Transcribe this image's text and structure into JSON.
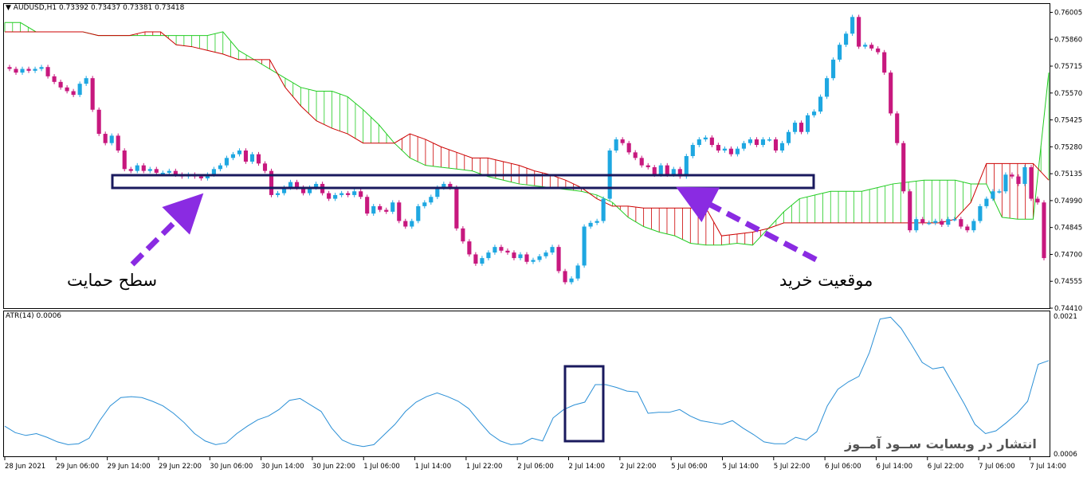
{
  "header": {
    "symbol_text": "AUDUSD,H1",
    "ohlc": "0.73392 0.73437 0.73381 0.73418",
    "menu_icon": "triangle-down-icon"
  },
  "atr_panel": {
    "label": "ATR(14) 0.0006",
    "y_ticks": [
      "0.0021",
      "0.0006"
    ]
  },
  "annotations": {
    "support": "سطح حمایت",
    "buy": "موقعیت خرید",
    "watermark": "انتشار در وبسایت ســود آمــوز"
  },
  "colors": {
    "bull": "#1ea7e1",
    "bear": "#c7187e",
    "cloud_bear": "#cc0000",
    "cloud_bull": "#22cc22",
    "atr": "#2a8fd6",
    "box": "#1a1a5e",
    "arrow": "#8a2be2"
  },
  "chart_data": [
    {
      "type": "candlestick",
      "title": "AUDUSD,H1",
      "ylim": [
        0.7441,
        0.7605
      ],
      "y_ticks": [
        "0.76005",
        "0.75860",
        "0.75715",
        "0.75570",
        "0.75425",
        "0.75280",
        "0.75135",
        "0.74990",
        "0.74845",
        "0.74700",
        "0.74555",
        "0.74410"
      ],
      "x_ticks": [
        "28 Jun 2021",
        "29 Jun 06:00",
        "29 Jun 14:00",
        "29 Jun 22:00",
        "30 Jun 06:00",
        "30 Jun 14:00",
        "30 Jun 22:00",
        "1 Jul 06:00",
        "1 Jul 14:00",
        "1 Jul 22:00",
        "2 Jul 06:00",
        "2 Jul 14:00",
        "2 Jul 22:00",
        "5 Jul 06:00",
        "5 Jul 14:00",
        "5 Jul 22:00",
        "6 Jul 06:00",
        "6 Jul 14:00",
        "6 Jul 22:00",
        "7 Jul 06:00",
        "7 Jul 14:00"
      ],
      "close": [
        0.757,
        0.7568,
        0.757,
        0.7569,
        0.757,
        0.7571,
        0.7566,
        0.7563,
        0.756,
        0.7558,
        0.7556,
        0.7562,
        0.7565,
        0.7548,
        0.7535,
        0.753,
        0.7534,
        0.7526,
        0.7516,
        0.7515,
        0.7518,
        0.7515,
        0.7516,
        0.7514,
        0.7514,
        0.7515,
        0.7513,
        0.7512,
        0.7513,
        0.7512,
        0.7511,
        0.7513,
        0.7516,
        0.7518,
        0.7522,
        0.7524,
        0.7526,
        0.752,
        0.7524,
        0.7519,
        0.7515,
        0.7502,
        0.7503,
        0.7506,
        0.7509,
        0.7506,
        0.7503,
        0.7506,
        0.7508,
        0.7503,
        0.75,
        0.7502,
        0.7503,
        0.7502,
        0.7504,
        0.7501,
        0.7492,
        0.7496,
        0.7494,
        0.7493,
        0.7498,
        0.7488,
        0.7485,
        0.7488,
        0.7496,
        0.7498,
        0.7501,
        0.7506,
        0.7508,
        0.7506,
        0.7484,
        0.7477,
        0.747,
        0.7465,
        0.7468,
        0.7471,
        0.7474,
        0.7472,
        0.7471,
        0.7468,
        0.747,
        0.7466,
        0.7467,
        0.7469,
        0.7471,
        0.7474,
        0.7461,
        0.7455,
        0.7457,
        0.7464,
        0.7485,
        0.7487,
        0.7488,
        0.75,
        0.7526,
        0.7532,
        0.753,
        0.7525,
        0.7522,
        0.7518,
        0.7517,
        0.7513,
        0.7518,
        0.7513,
        0.7516,
        0.7512,
        0.7523,
        0.7529,
        0.7532,
        0.7533,
        0.7529,
        0.7526,
        0.7527,
        0.7524,
        0.7527,
        0.753,
        0.7532,
        0.7529,
        0.7532,
        0.7532,
        0.7526,
        0.753,
        0.7536,
        0.7541,
        0.7536,
        0.7545,
        0.7547,
        0.7555,
        0.7565,
        0.7575,
        0.7583,
        0.7589,
        0.7598,
        0.7582,
        0.7583,
        0.7581,
        0.7579,
        0.7568,
        0.7546,
        0.753,
        0.7504,
        0.7483,
        0.7489,
        0.7487,
        0.7487,
        0.7488,
        0.7486,
        0.7489,
        0.7489,
        0.7485,
        0.7483,
        0.7488,
        0.7496,
        0.75,
        0.7504,
        0.7504,
        0.7513,
        0.7512,
        0.7508,
        0.7517,
        0.75,
        0.7498,
        0.7468
      ],
      "series": [
        {
          "name": "Ichimoku Senkou Span A",
          "values": [
            0.7595,
            0.7595,
            0.759,
            0.759,
            0.759,
            0.759,
            0.7588,
            0.7588,
            0.7588,
            0.7588,
            0.7588,
            0.7588,
            0.7588,
            0.7588,
            0.759,
            0.758,
            0.7575,
            0.757,
            0.7565,
            0.756,
            0.7558,
            0.7558,
            0.7555,
            0.7548,
            0.754,
            0.753,
            0.7522,
            0.7518,
            0.7517,
            0.7516,
            0.7515,
            0.7512,
            0.751,
            0.7508,
            0.7507,
            0.7506,
            0.7505,
            0.7504,
            0.7502,
            0.7498,
            0.749,
            0.7485,
            0.7482,
            0.748,
            0.7476,
            0.7475,
            0.7475,
            0.7476,
            0.7475,
            0.7484,
            0.7493,
            0.75,
            0.7502,
            0.7504,
            0.7504,
            0.7504,
            0.7506,
            0.7508,
            0.7509,
            0.751,
            0.751,
            0.751,
            0.7508,
            0.7508,
            0.749,
            0.7489,
            0.7489,
            0.7568
          ]
        },
        {
          "name": "Ichimoku Senkou Span B",
          "values": [
            0.759,
            0.759,
            0.759,
            0.759,
            0.759,
            0.759,
            0.7588,
            0.7588,
            0.7588,
            0.759,
            0.759,
            0.7583,
            0.7582,
            0.758,
            0.7578,
            0.7575,
            0.7575,
            0.7575,
            0.756,
            0.755,
            0.7542,
            0.7538,
            0.7535,
            0.753,
            0.753,
            0.753,
            0.7535,
            0.7532,
            0.7528,
            0.7525,
            0.7522,
            0.7522,
            0.752,
            0.7518,
            0.7515,
            0.7513,
            0.751,
            0.7506,
            0.75,
            0.7496,
            0.7496,
            0.7495,
            0.7495,
            0.7495,
            0.7495,
            0.7495,
            0.748,
            0.7481,
            0.7482,
            0.7484,
            0.7487,
            0.7487,
            0.7487,
            0.7487,
            0.7487,
            0.7487,
            0.7487,
            0.7487,
            0.7487,
            0.7487,
            0.7487,
            0.7489,
            0.7498,
            0.7519,
            0.7519,
            0.7519,
            0.7519,
            0.751
          ]
        }
      ]
    },
    {
      "type": "line",
      "title": "ATR(14) 0.0006",
      "ylim": [
        0.0006,
        0.0021
      ],
      "series": [
        {
          "name": "ATR(14)",
          "values": [
            0.0009,
            0.00083,
            0.0008,
            0.00082,
            0.00078,
            0.00073,
            0.0007,
            0.00071,
            0.00077,
            0.00096,
            0.00112,
            0.00121,
            0.00122,
            0.00121,
            0.00117,
            0.00112,
            0.00104,
            0.00094,
            0.00082,
            0.00074,
            0.0007,
            0.00072,
            0.00082,
            0.0009,
            0.00097,
            0.00101,
            0.00108,
            0.00118,
            0.0012,
            0.00113,
            0.00106,
            0.00088,
            0.00075,
            0.0007,
            0.00068,
            0.0007,
            0.00081,
            0.00092,
            0.00106,
            0.00116,
            0.00122,
            0.00126,
            0.00122,
            0.00117,
            0.00109,
            0.00095,
            0.00082,
            0.00074,
            0.0007,
            0.00071,
            0.00077,
            0.00074,
            0.00099,
            0.00108,
            0.00113,
            0.00116,
            0.00135,
            0.00135,
            0.00132,
            0.00128,
            0.00127,
            0.00104,
            0.00105,
            0.00105,
            0.00108,
            0.00101,
            0.00096,
            0.00094,
            0.00092,
            0.00096,
            0.00088,
            0.00081,
            0.00073,
            0.00071,
            0.00071,
            0.00078,
            0.00075,
            0.00084,
            0.00112,
            0.0013,
            0.00138,
            0.00144,
            0.0017,
            0.00206,
            0.00208,
            0.00196,
            0.00178,
            0.00159,
            0.00152,
            0.00154,
            0.00134,
            0.00114,
            0.00092,
            0.00082,
            0.00085,
            0.00094,
            0.00104,
            0.00117,
            0.00157,
            0.00161
          ]
        }
      ]
    }
  ]
}
